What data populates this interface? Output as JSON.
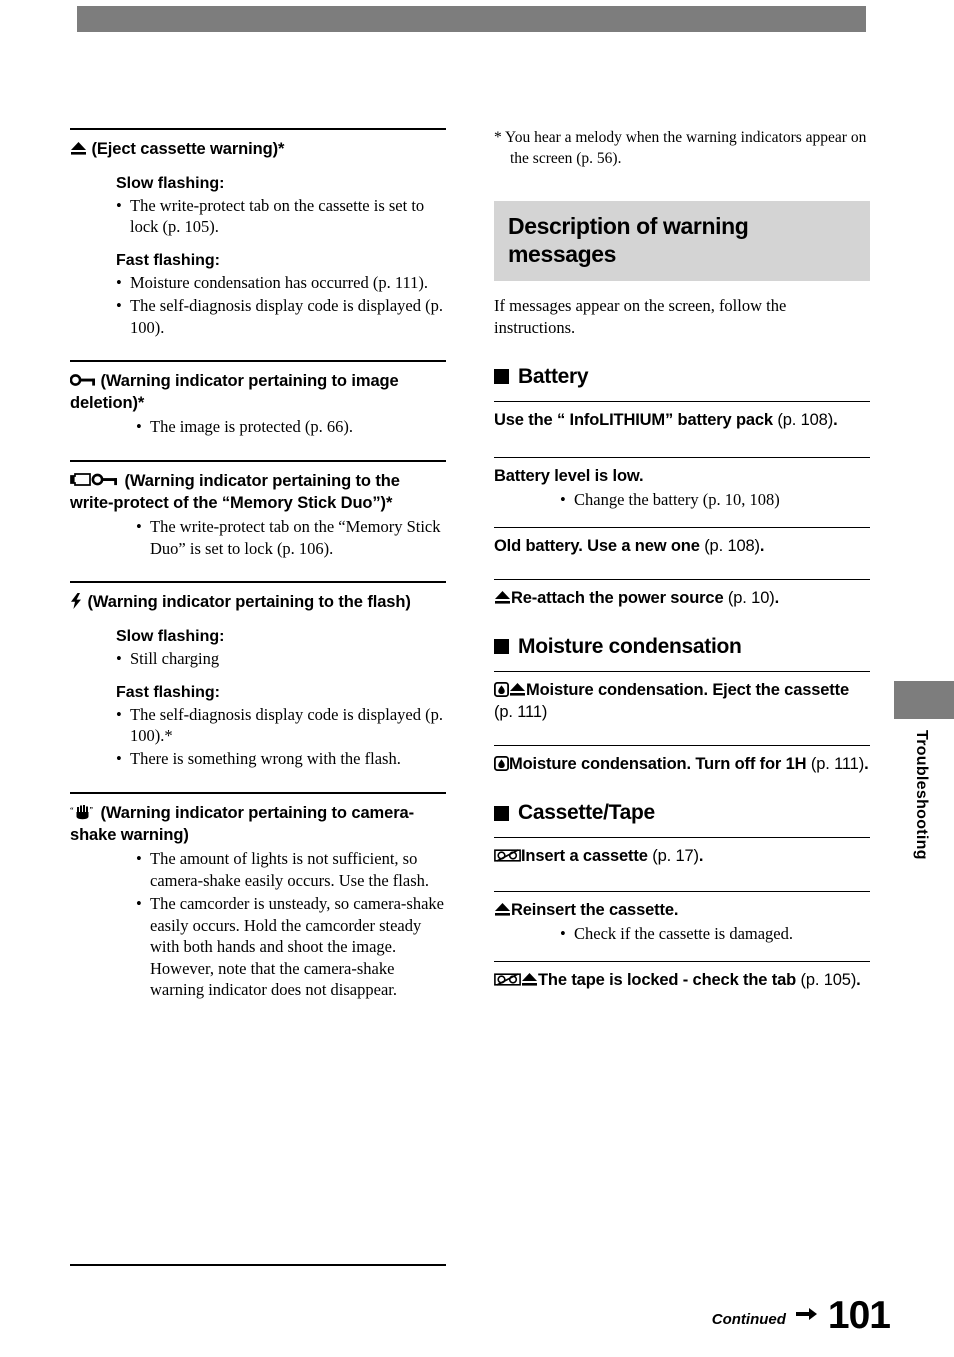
{
  "page": {
    "number": "101",
    "continued_label": "Continued",
    "side_tab_label": "Troubleshooting"
  },
  "left_column": {
    "sections": [
      {
        "icon": "eject-icon",
        "heading": "(Eject cassette warning)*",
        "groups": [
          {
            "label": "Slow flashing:",
            "items": [
              "The write-protect tab on the cassette is set to lock (p. 105)."
            ]
          },
          {
            "label": "Fast flashing:",
            "items": [
              "Moisture condensation has occurred (p. 111).",
              "The self-diagnosis display code is displayed (p. 100)."
            ]
          }
        ]
      },
      {
        "icon": "key-icon",
        "heading": "(Warning indicator pertaining to image deletion)*",
        "groups": [
          {
            "label": "",
            "items": [
              "The image is protected (p. 66)."
            ]
          }
        ]
      },
      {
        "icon": "memory-stick-key-icon",
        "heading": "(Warning indicator pertaining to the write-protect of the “Memory Stick Duo”)*",
        "groups": [
          {
            "label": "",
            "items": [
              "The write-protect tab on the “Memory Stick Duo” is set to lock (p. 106)."
            ]
          }
        ]
      },
      {
        "icon": "flash-icon",
        "heading": "(Warning indicator pertaining to the flash)",
        "groups": [
          {
            "label": "Slow flashing:",
            "items": [
              "Still charging"
            ]
          },
          {
            "label": "Fast flashing:",
            "items": [
              "The self-diagnosis display code is displayed (p. 100).*",
              "There is something wrong with the flash."
            ]
          }
        ]
      },
      {
        "icon": "hand-shake-icon",
        "heading": "(Warning indicator pertaining to camera-shake warning)",
        "groups": [
          {
            "label": "",
            "items": [
              "The amount of lights is not sufficient, so camera-shake easily occurs. Use the flash.",
              "The camcorder is unsteady, so camera-shake easily occurs. Hold the camcorder steady with both hands and shoot the image. However, note that the camera-shake warning indicator does not disappear."
            ]
          }
        ]
      }
    ]
  },
  "right_column": {
    "footnote": "* You hear a melody when the warning indicators appear on the screen (p. 56).",
    "section_title": "Description of warning messages",
    "intro": "If messages appear on the screen, follow the instructions.",
    "groups": [
      {
        "title": "Battery",
        "messages": [
          {
            "icon": "",
            "bold": "Use the “ InfoLITHIUM” battery pack ",
            "page": "(p. 108)",
            "tail": ".",
            "items": []
          },
          {
            "icon": "",
            "bold": "Battery level is low.",
            "page": "",
            "tail": "",
            "items": [
              "Change the battery (p. 10, 108)"
            ]
          },
          {
            "icon": "",
            "bold": "Old battery. Use a new one ",
            "page": "(p. 108)",
            "tail": ".",
            "items": []
          },
          {
            "icon": "eject-icon",
            "bold": "Re-attach the power source ",
            "page": "(p. 10)",
            "tail": ".",
            "items": []
          }
        ]
      },
      {
        "title": "Moisture condensation",
        "messages": [
          {
            "icon": "moisture-eject-icon",
            "bold": "Moisture condensation. Eject the cassette ",
            "page": "(p. 111)",
            "tail": "",
            "items": []
          },
          {
            "icon": "moisture-icon",
            "bold": "Moisture condensation. Turn off for 1H ",
            "page": "(p. 111)",
            "tail": ".",
            "items": []
          }
        ]
      },
      {
        "title": "Cassette/Tape",
        "messages": [
          {
            "icon": "cassette-icon",
            "bold": "Insert a cassette ",
            "page": "(p. 17)",
            "tail": ".",
            "items": []
          },
          {
            "icon": "eject-icon",
            "bold": "Reinsert the cassette.",
            "page": "",
            "tail": "",
            "items": [
              "Check if the cassette is damaged."
            ]
          },
          {
            "icon": "cassette-eject-icon",
            "bold": "The tape is locked - check the tab ",
            "page": "(p. 105)",
            "tail": ".",
            "items": []
          }
        ]
      }
    ]
  },
  "colors": {
    "top_bar": "#7d7d7d",
    "heading_bg": "#d4d4d4",
    "side_tab": "#7d7d7d"
  }
}
